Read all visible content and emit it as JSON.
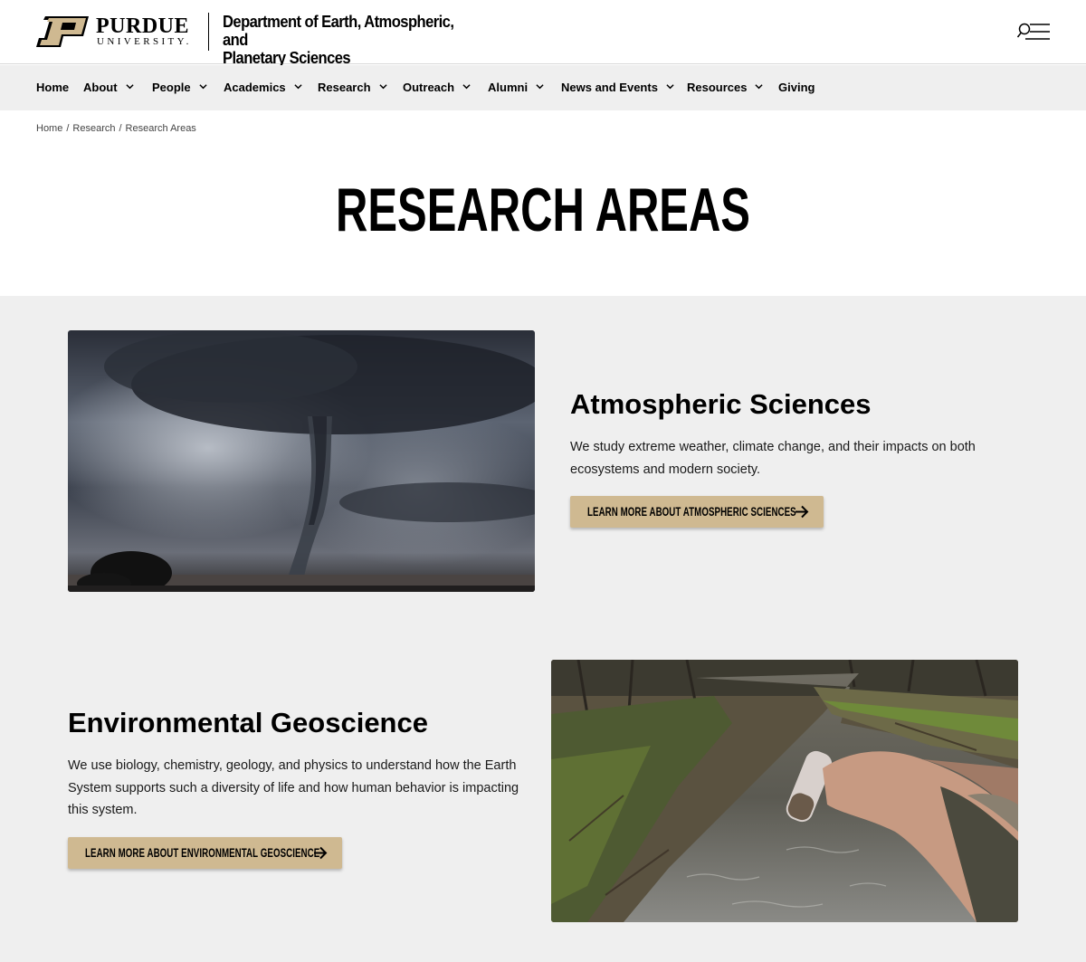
{
  "header": {
    "logo_word": "PURDUE",
    "logo_sub": "UNIVERSITY.",
    "department_line1": "Department of Earth, Atmospheric, and",
    "department_line2": "Planetary Sciences",
    "search_menu_icon": "search-menu-icon"
  },
  "nav": {
    "items": [
      {
        "label": "Home",
        "dropdown": false
      },
      {
        "label": "About",
        "dropdown": true
      },
      {
        "label": "People",
        "dropdown": true
      },
      {
        "label": "Academics",
        "dropdown": true
      },
      {
        "label": "Research",
        "dropdown": true
      },
      {
        "label": "Outreach",
        "dropdown": true
      },
      {
        "label": "Alumni",
        "dropdown": true
      },
      {
        "label": "News and Events",
        "dropdown": true
      },
      {
        "label": "Resources",
        "dropdown": true
      },
      {
        "label": "Giving",
        "dropdown": false
      }
    ]
  },
  "breadcrumb": [
    "Home",
    "Research",
    "Research Areas"
  ],
  "page_title": "RESEARCH AREAS",
  "areas": [
    {
      "title": "Atmospheric Sciences",
      "desc_line1": "We study extreme weather, climate change, and their impacts on both",
      "desc_line2": "ecosystems and modern society.",
      "button": "LEARN MORE ABOUT ATMOSPHERIC SCIENCES",
      "image": "tornado-photo"
    },
    {
      "title": "Environmental Geoscience",
      "desc_line1": "We use biology, chemistry, geology, and physics to understand how the Earth",
      "desc_line2": "System supports such a diversity of life and how human behavior is impacting",
      "desc_line3": "this system.",
      "button": "LEARN MORE ABOUT ENVIRONMENTAL GEOSCIENCE",
      "image": "stream-sample-photo"
    }
  ],
  "colors": {
    "gold": "#cfb991",
    "nav_bg": "#efefef",
    "section_bg": "#efefef",
    "black": "#000000"
  }
}
